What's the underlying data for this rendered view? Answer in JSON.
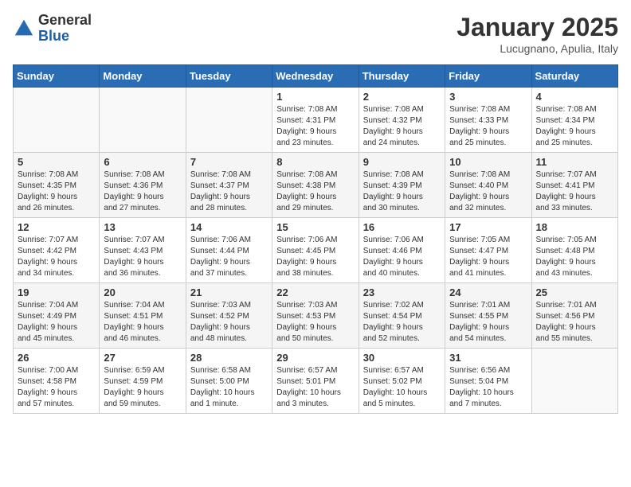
{
  "header": {
    "logo_general": "General",
    "logo_blue": "Blue",
    "month": "January 2025",
    "location": "Lucugnano, Apulia, Italy"
  },
  "weekdays": [
    "Sunday",
    "Monday",
    "Tuesday",
    "Wednesday",
    "Thursday",
    "Friday",
    "Saturday"
  ],
  "weeks": [
    [
      {
        "day": "",
        "info": ""
      },
      {
        "day": "",
        "info": ""
      },
      {
        "day": "",
        "info": ""
      },
      {
        "day": "1",
        "info": "Sunrise: 7:08 AM\nSunset: 4:31 PM\nDaylight: 9 hours\nand 23 minutes."
      },
      {
        "day": "2",
        "info": "Sunrise: 7:08 AM\nSunset: 4:32 PM\nDaylight: 9 hours\nand 24 minutes."
      },
      {
        "day": "3",
        "info": "Sunrise: 7:08 AM\nSunset: 4:33 PM\nDaylight: 9 hours\nand 25 minutes."
      },
      {
        "day": "4",
        "info": "Sunrise: 7:08 AM\nSunset: 4:34 PM\nDaylight: 9 hours\nand 25 minutes."
      }
    ],
    [
      {
        "day": "5",
        "info": "Sunrise: 7:08 AM\nSunset: 4:35 PM\nDaylight: 9 hours\nand 26 minutes."
      },
      {
        "day": "6",
        "info": "Sunrise: 7:08 AM\nSunset: 4:36 PM\nDaylight: 9 hours\nand 27 minutes."
      },
      {
        "day": "7",
        "info": "Sunrise: 7:08 AM\nSunset: 4:37 PM\nDaylight: 9 hours\nand 28 minutes."
      },
      {
        "day": "8",
        "info": "Sunrise: 7:08 AM\nSunset: 4:38 PM\nDaylight: 9 hours\nand 29 minutes."
      },
      {
        "day": "9",
        "info": "Sunrise: 7:08 AM\nSunset: 4:39 PM\nDaylight: 9 hours\nand 30 minutes."
      },
      {
        "day": "10",
        "info": "Sunrise: 7:08 AM\nSunset: 4:40 PM\nDaylight: 9 hours\nand 32 minutes."
      },
      {
        "day": "11",
        "info": "Sunrise: 7:07 AM\nSunset: 4:41 PM\nDaylight: 9 hours\nand 33 minutes."
      }
    ],
    [
      {
        "day": "12",
        "info": "Sunrise: 7:07 AM\nSunset: 4:42 PM\nDaylight: 9 hours\nand 34 minutes."
      },
      {
        "day": "13",
        "info": "Sunrise: 7:07 AM\nSunset: 4:43 PM\nDaylight: 9 hours\nand 36 minutes."
      },
      {
        "day": "14",
        "info": "Sunrise: 7:06 AM\nSunset: 4:44 PM\nDaylight: 9 hours\nand 37 minutes."
      },
      {
        "day": "15",
        "info": "Sunrise: 7:06 AM\nSunset: 4:45 PM\nDaylight: 9 hours\nand 38 minutes."
      },
      {
        "day": "16",
        "info": "Sunrise: 7:06 AM\nSunset: 4:46 PM\nDaylight: 9 hours\nand 40 minutes."
      },
      {
        "day": "17",
        "info": "Sunrise: 7:05 AM\nSunset: 4:47 PM\nDaylight: 9 hours\nand 41 minutes."
      },
      {
        "day": "18",
        "info": "Sunrise: 7:05 AM\nSunset: 4:48 PM\nDaylight: 9 hours\nand 43 minutes."
      }
    ],
    [
      {
        "day": "19",
        "info": "Sunrise: 7:04 AM\nSunset: 4:49 PM\nDaylight: 9 hours\nand 45 minutes."
      },
      {
        "day": "20",
        "info": "Sunrise: 7:04 AM\nSunset: 4:51 PM\nDaylight: 9 hours\nand 46 minutes."
      },
      {
        "day": "21",
        "info": "Sunrise: 7:03 AM\nSunset: 4:52 PM\nDaylight: 9 hours\nand 48 minutes."
      },
      {
        "day": "22",
        "info": "Sunrise: 7:03 AM\nSunset: 4:53 PM\nDaylight: 9 hours\nand 50 minutes."
      },
      {
        "day": "23",
        "info": "Sunrise: 7:02 AM\nSunset: 4:54 PM\nDaylight: 9 hours\nand 52 minutes."
      },
      {
        "day": "24",
        "info": "Sunrise: 7:01 AM\nSunset: 4:55 PM\nDaylight: 9 hours\nand 54 minutes."
      },
      {
        "day": "25",
        "info": "Sunrise: 7:01 AM\nSunset: 4:56 PM\nDaylight: 9 hours\nand 55 minutes."
      }
    ],
    [
      {
        "day": "26",
        "info": "Sunrise: 7:00 AM\nSunset: 4:58 PM\nDaylight: 9 hours\nand 57 minutes."
      },
      {
        "day": "27",
        "info": "Sunrise: 6:59 AM\nSunset: 4:59 PM\nDaylight: 9 hours\nand 59 minutes."
      },
      {
        "day": "28",
        "info": "Sunrise: 6:58 AM\nSunset: 5:00 PM\nDaylight: 10 hours\nand 1 minute."
      },
      {
        "day": "29",
        "info": "Sunrise: 6:57 AM\nSunset: 5:01 PM\nDaylight: 10 hours\nand 3 minutes."
      },
      {
        "day": "30",
        "info": "Sunrise: 6:57 AM\nSunset: 5:02 PM\nDaylight: 10 hours\nand 5 minutes."
      },
      {
        "day": "31",
        "info": "Sunrise: 6:56 AM\nSunset: 5:04 PM\nDaylight: 10 hours\nand 7 minutes."
      },
      {
        "day": "",
        "info": ""
      }
    ]
  ]
}
